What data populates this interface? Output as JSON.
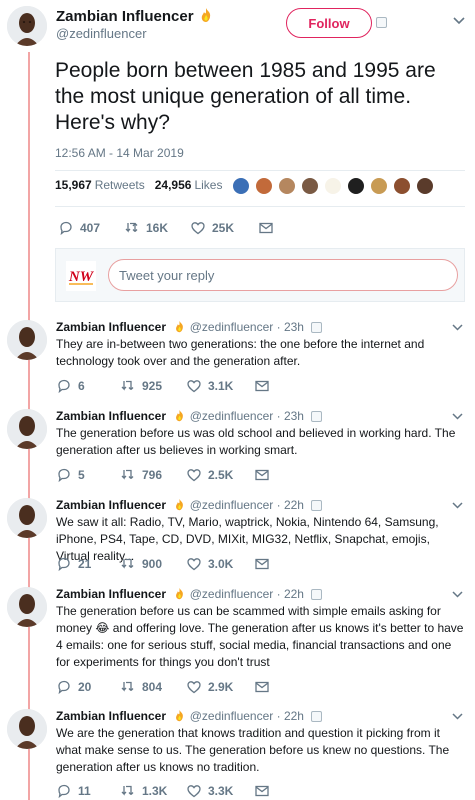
{
  "main": {
    "name": "Zambian Influencer",
    "handle": "@zedinfluencer",
    "follow_label": "Follow",
    "text": "People born between 1985 and 1995 are the most unique generation of all time. Here's why?",
    "time": "12:56 AM - 14 Mar 2019",
    "retweets_count": "15,967",
    "retweets_label": "Retweets",
    "likes_count": "24,956",
    "likes_label": "Likes",
    "reply_count": "407",
    "retweet_count": "16K",
    "like_count": "25K"
  },
  "reply_box": {
    "logo_text": "NW",
    "placeholder": "Tweet your reply"
  },
  "replies": [
    {
      "name": "Zambian Influencer",
      "handle": "@zedinfluencer",
      "time": "· 23h",
      "text": "They are in-between two generations: the one before the internet and technology took over and the generation after.",
      "replies": "6",
      "retweets": "925",
      "likes": "3.1K"
    },
    {
      "name": "Zambian Influencer",
      "handle": "@zedinfluencer",
      "time": "· 23h",
      "text": "The generation before us was old school and believed in working hard. The generation after us believes in working smart.",
      "replies": "5",
      "retweets": "796",
      "likes": "2.5K"
    },
    {
      "name": "Zambian Influencer",
      "handle": "@zedinfluencer",
      "time": "· 22h",
      "text": "We saw it all: Radio, TV, Mario, waptrick, Nokia, Nintendo 64, Samsung, iPhone, PS4, Tape, CD, DVD, MIXit, MIG32, Netflix, Snapchat, emojis, Virtual reality...",
      "replies": "21",
      "retweets": "900",
      "likes": "3.0K"
    },
    {
      "name": "Zambian Influencer",
      "handle": "@zedinfluencer",
      "time": "· 22h",
      "text_a": "The generation before us can be scammed with simple emails asking for money",
      "emoji": "😂",
      "text_b": " and offering love. The generation after us knows it's better to have 4 emails: one for serious stuff, social media, financial transactions and one for experiments for things you don't trust",
      "replies": "20",
      "retweets": "804",
      "likes": "2.9K"
    },
    {
      "name": "Zambian Influencer",
      "handle": "@zedinfluencer",
      "time": "· 22h",
      "text": "We are the generation that knows tradition and question it picking from it what make sense to us. The generation before us knew no questions. The generation after us knows no tradition.",
      "replies": "11",
      "retweets": "1.3K",
      "likes": "3.3K"
    }
  ],
  "icons": {
    "reply": "reply-icon",
    "retweet": "retweet-icon",
    "like": "heart-icon",
    "dm": "envelope-icon",
    "more": "chevron-down-icon",
    "verified_badge": "fire-icon"
  },
  "colors": {
    "follow": "#e0245e",
    "thread_line": "#f2a5a5",
    "muted": "#657786",
    "text": "#14171a"
  }
}
